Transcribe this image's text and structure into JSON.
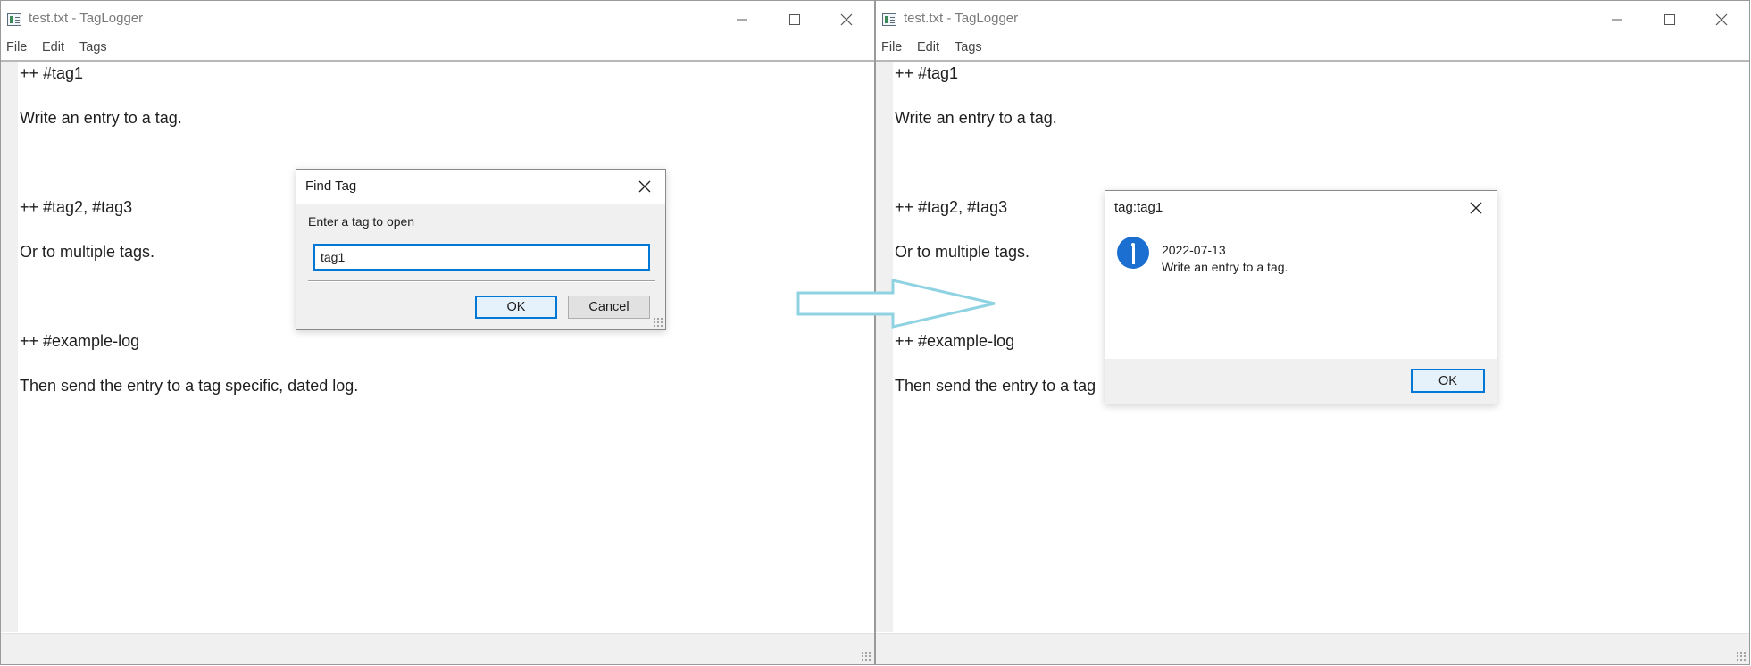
{
  "window_left": {
    "title": "test.txt - TagLogger",
    "menu": [
      "File",
      "Edit",
      "Tags"
    ],
    "lines": [
      "++ #tag1",
      "Write an entry to a tag.",
      "++ #tag2, #tag3",
      "Or to multiple tags.",
      "++ #example-log",
      "Then send the entry to a tag specific, dated log."
    ]
  },
  "window_right": {
    "title": "test.txt - TagLogger",
    "menu": [
      "File",
      "Edit",
      "Tags"
    ],
    "lines": [
      "++ #tag1",
      "Write an entry to a tag.",
      "++ #tag2, #tag3",
      "Or to multiple tags.",
      "++ #example-log",
      "Then send the entry to a tag"
    ]
  },
  "find_dialog": {
    "title": "Find Tag",
    "prompt": "Enter a tag to open",
    "input_value": "tag1",
    "ok_label": "OK",
    "cancel_label": "Cancel"
  },
  "message_box": {
    "title": "tag:tag1",
    "date": "2022-07-13",
    "text": "Write an entry to a tag.",
    "ok_label": "OK",
    "icon": "info-icon"
  },
  "colors": {
    "accent": "#0078d7",
    "arrow": "#8fd3e3",
    "info_icon": "#1a6fd0"
  }
}
